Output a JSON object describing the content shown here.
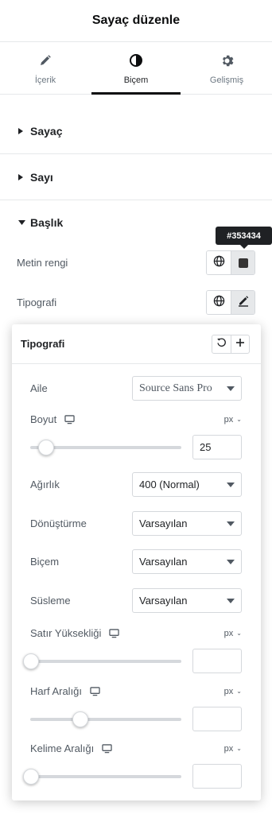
{
  "header": {
    "title": "Sayaç düzenle"
  },
  "tabs": [
    {
      "label": "İçerik",
      "icon": "pencil-icon"
    },
    {
      "label": "Biçem",
      "icon": "half-circle-icon",
      "active": true
    },
    {
      "label": "Gelişmiş",
      "icon": "gear-icon"
    }
  ],
  "sections": [
    {
      "title": "Sayaç",
      "expanded": false
    },
    {
      "title": "Sayı",
      "expanded": false
    },
    {
      "title": "Başlık",
      "expanded": true
    }
  ],
  "text_color": {
    "label": "Metin rengi",
    "tooltip": "#353434",
    "swatch": "#353434"
  },
  "typography_row": {
    "label": "Tipografi"
  },
  "popover": {
    "title": "Tipografi",
    "family": {
      "label": "Aile",
      "value": "Source Sans Pro"
    },
    "size": {
      "label": "Boyut",
      "unit": "px",
      "value": "25",
      "level": 0.1
    },
    "weight": {
      "label": "Ağırlık",
      "value": "400 (Normal)"
    },
    "transform": {
      "label": "Dönüştürme",
      "value": "Varsayılan"
    },
    "style": {
      "label": "Biçem",
      "value": "Varsayılan"
    },
    "decoration": {
      "label": "Süsleme",
      "value": "Varsayılan"
    },
    "line_height": {
      "label": "Satır Yüksekliği",
      "unit": "px",
      "value": "",
      "level": 0.0
    },
    "letter_spacing": {
      "label": "Harf Aralığı",
      "unit": "px",
      "value": "",
      "level": 0.33
    },
    "word_spacing": {
      "label": "Kelime Aralığı",
      "unit": "px",
      "value": "",
      "level": 0.0
    }
  },
  "colors": {
    "accent": "#0c0d0e",
    "tooltip_bg": "#1f2124",
    "border": "#d5d8dc"
  }
}
